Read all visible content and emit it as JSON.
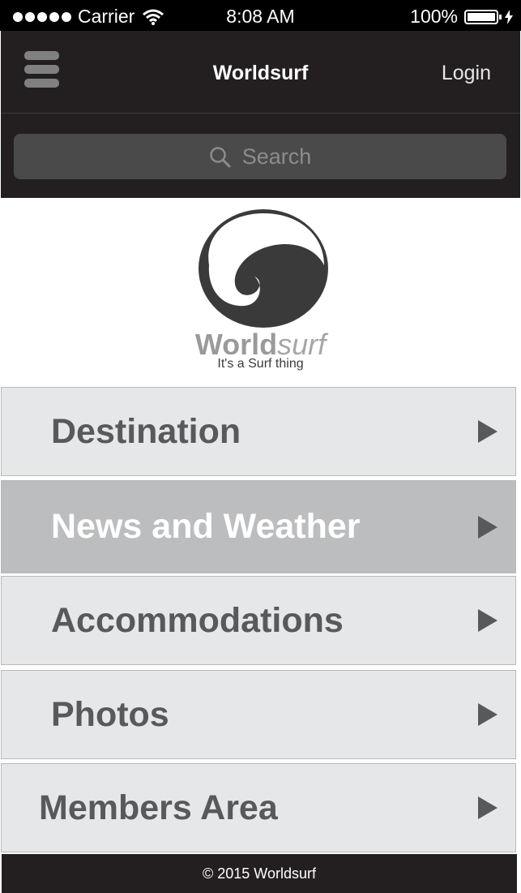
{
  "status_bar": {
    "carrier": "Carrier",
    "time": "8:08 AM",
    "battery": "100%"
  },
  "nav": {
    "title": "Worldsurf",
    "login": "Login"
  },
  "search": {
    "placeholder": "Search"
  },
  "logo": {
    "word_bold": "World",
    "word_light": "surf",
    "tagline": "It's a Surf thing"
  },
  "menu": {
    "items": [
      {
        "label": "Destination"
      },
      {
        "label": "News and Weather"
      },
      {
        "label": "Accommodations"
      },
      {
        "label": "Photos"
      },
      {
        "label": "Members Area"
      }
    ]
  },
  "footer": {
    "text": "© 2015 Worldsurf"
  },
  "colors": {
    "nav_bg": "#231f20",
    "menu_bg": "#e6e7e8",
    "menu_active_bg": "#bcbdbf",
    "menu_text": "#58595b"
  }
}
